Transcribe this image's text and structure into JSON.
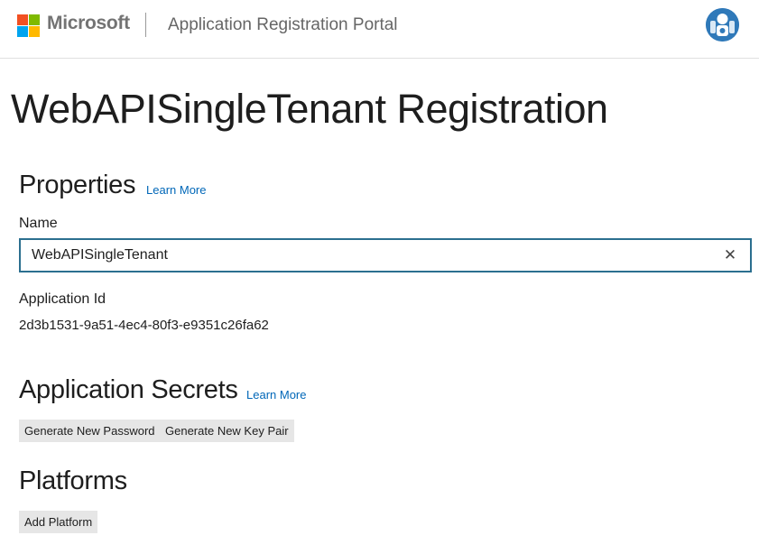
{
  "header": {
    "brand": "Microsoft",
    "portal_title": "Application Registration Portal",
    "logo_icon": "microsoft-logo-icon",
    "avatar_icon": "user-avatar-icon"
  },
  "page": {
    "title": "WebAPISingleTenant Registration"
  },
  "properties": {
    "heading": "Properties",
    "learn_more": "Learn More",
    "name_label": "Name",
    "name_value": "WebAPISingleTenant",
    "clear_glyph": "✕",
    "app_id_label": "Application Id",
    "app_id_value": "2d3b1531-9a51-4ec4-80f3-e9351c26fa62"
  },
  "secrets": {
    "heading": "Application Secrets",
    "learn_more": "Learn More",
    "generate_password": "Generate New Password",
    "generate_key_pair": "Generate New Key Pair"
  },
  "platforms": {
    "heading": "Platforms",
    "add_platform": "Add Platform"
  },
  "colors": {
    "accent_link": "#0067b8",
    "input_border": "#2b6f8f",
    "button_bg": "#e6e6e6"
  }
}
